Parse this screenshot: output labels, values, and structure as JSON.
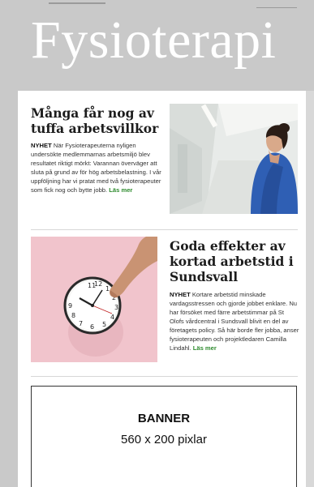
{
  "masthead": {
    "title": "Fysioterapi"
  },
  "articles": [
    {
      "headline": "Många får nog av tuffa arbetsvillkor",
      "tag": "NYHET",
      "body": " När Fysioterapeuterna nyligen undersökte medlemmarnas arbetsmiljö blev resultatet riktigt mörkt: Varannan överväger att sluta på grund av för hög arbetsbelastning. I vår uppföljning har vi pratat med två fysioterapeuter som fick nog och bytte jobb. ",
      "more": "Läs mer",
      "image": "nurse-in-corridor-photo"
    },
    {
      "headline": "Goda effekter av kortad arbetstid i Sundsvall",
      "tag": "NYHET",
      "body": " Kortare arbetstid minskade vardagsstressen och gjorde jobbet enklare. Nu har försöket med färre arbetstimmar på St Olofs vårdcentral i Sundsvall blivit en del av företagets policy. Så här borde fler jobba, anser fysioterapeuten och projektledaren Camilla Lindahl. ",
      "more": "Läs mer",
      "image": "hand-turning-clock-photo"
    }
  ],
  "banner": {
    "line1": "BANNER",
    "line2": "560 x 200 pixlar"
  },
  "colors": {
    "masthead_bg": "#c9c9c9",
    "link_green": "#2e8b2e",
    "photo_pink": "#f1c4cc"
  }
}
